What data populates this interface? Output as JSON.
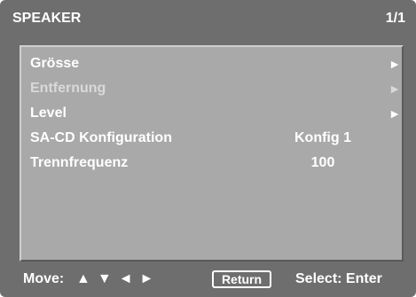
{
  "header": {
    "title": "SPEAKER",
    "page": "1/1"
  },
  "menu": {
    "items": [
      {
        "label": "Grösse",
        "value": "",
        "arrow": "►",
        "enabled": true
      },
      {
        "label": "Entfernung",
        "value": "",
        "arrow": "►",
        "enabled": false
      },
      {
        "label": "Level",
        "value": "",
        "arrow": "►",
        "enabled": true
      },
      {
        "label": "SA-CD Konfiguration",
        "value": "Konfig 1",
        "arrow": "",
        "enabled": true
      },
      {
        "label": "Trennfrequenz",
        "value": "100",
        "arrow": "",
        "enabled": true
      }
    ]
  },
  "footer": {
    "move_label": "Move:",
    "arrows": [
      "▲",
      "▼",
      "◄",
      "►"
    ],
    "return_label": "Return",
    "select_label": "Select: Enter"
  },
  "colors": {
    "background": "#6e6e6e",
    "panel": "#a9a9a9",
    "text": "#ffffff",
    "disabled_text": "#d9d9d9"
  }
}
